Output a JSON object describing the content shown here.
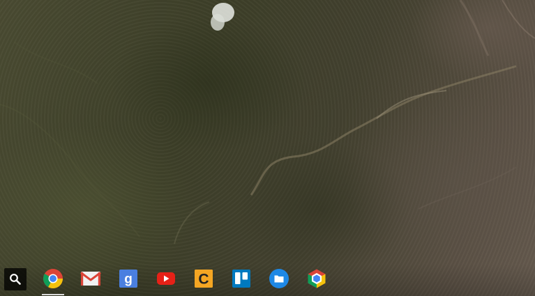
{
  "screen": {
    "type": "chrome-os-desktop",
    "wallpaper": "aerial-forest-terrain"
  },
  "shelf": {
    "launcher": {
      "icon": "search-icon"
    },
    "apps": [
      {
        "name": "chrome",
        "icon": "chrome-icon",
        "running": true
      },
      {
        "name": "gmail",
        "icon": "gmail-icon",
        "running": false
      },
      {
        "name": "google-search",
        "icon": "google-g-icon",
        "running": false
      },
      {
        "name": "youtube",
        "icon": "youtube-icon",
        "running": false
      },
      {
        "name": "caret",
        "icon": "caret-c-icon",
        "running": false
      },
      {
        "name": "trello",
        "icon": "trello-icon",
        "running": false
      },
      {
        "name": "files",
        "icon": "folder-icon",
        "running": false
      },
      {
        "name": "chrome-remote-desktop",
        "icon": "remote-desktop-icon",
        "running": false
      }
    ],
    "icon_colors": {
      "chrome_red": "#db4437",
      "chrome_yellow": "#f4c20d",
      "chrome_green": "#0f9d58",
      "chrome_blue": "#4285f4",
      "youtube_red": "#e62117",
      "caret_orange": "#f5a623",
      "trello_blue": "#0079bf",
      "files_blue": "#1e88e5"
    }
  }
}
